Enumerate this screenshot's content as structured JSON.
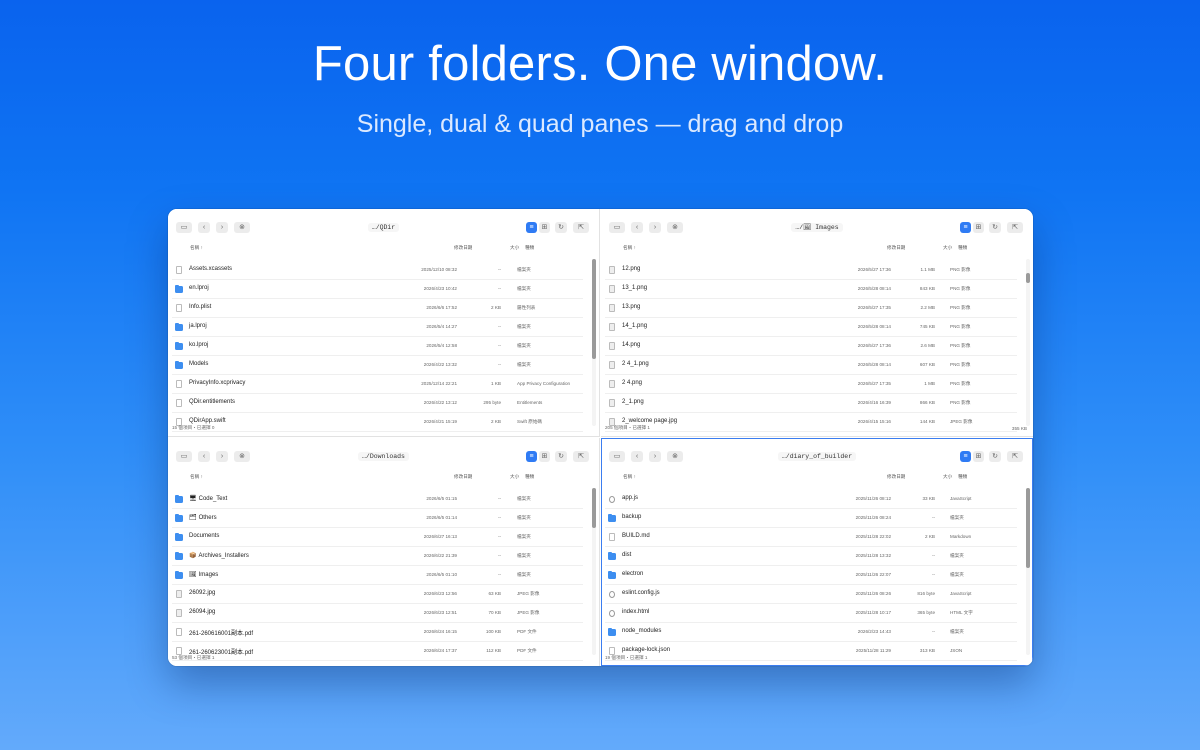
{
  "hero": {
    "title": "Four folders. One window.",
    "subtitle": "Single, dual & quad panes — drag and drop"
  },
  "colors": {
    "accent": "#2f7bf4",
    "folder": "#3d8ef0",
    "background_top": "#0a63ee"
  },
  "columns": {
    "name": "名稱 ↑",
    "date": "修改日期",
    "size": "大小",
    "kind": "種類"
  },
  "panes": [
    {
      "path": "…/QDir",
      "rows": [
        {
          "icon": "file-icon",
          "name": "Assets.xcassets",
          "date": "2025/12/10 08:32",
          "size": "--",
          "kind": "檔案夾"
        },
        {
          "icon": "folder-icon",
          "name": "en.lproj",
          "date": "2026/4/23 10:42",
          "size": "--",
          "kind": "檔案夾"
        },
        {
          "icon": "file-icon",
          "name": "Info.plist",
          "date": "2026/6/6 17:52",
          "size": "2 KB",
          "kind": "屬性列表"
        },
        {
          "icon": "folder-icon",
          "name": "ja.lproj",
          "date": "2026/5/4 14:27",
          "size": "--",
          "kind": "檔案夾"
        },
        {
          "icon": "folder-icon",
          "name": "ko.lproj",
          "date": "2026/5/4 12:58",
          "size": "--",
          "kind": "檔案夾"
        },
        {
          "icon": "folder-icon",
          "name": "Models",
          "date": "2026/4/22 13:32",
          "size": "--",
          "kind": "檔案夾"
        },
        {
          "icon": "file-icon",
          "name": "PrivacyInfo.xcprivacy",
          "date": "2025/12/14 22:21",
          "size": "1 KB",
          "kind": "App Privacy Configuration"
        },
        {
          "icon": "file-icon",
          "name": "QDir.entitlements",
          "date": "2026/4/22 13:12",
          "size": "295 byte",
          "kind": "Entitlements"
        },
        {
          "icon": "file-icon",
          "name": "QDirApp.swift",
          "date": "2026/4/21 15:19",
          "size": "2 KB",
          "kind": "Swift 原始碼"
        }
      ],
      "status": "15 個項目・已選擇 0",
      "status_right": ""
    },
    {
      "path": "…/🖼 Images",
      "rows": [
        {
          "icon": "image-icon",
          "name": "12.png",
          "date": "2026/5/27 17:36",
          "size": "1.1 MB",
          "kind": "PNG 影像"
        },
        {
          "icon": "image-icon",
          "name": "13_1.png",
          "date": "2026/5/28 08:14",
          "size": "843 KB",
          "kind": "PNG 影像"
        },
        {
          "icon": "image-icon",
          "name": "13.png",
          "date": "2026/5/27 17:35",
          "size": "2.2 MB",
          "kind": "PNG 影像"
        },
        {
          "icon": "image-icon",
          "name": "14_1.png",
          "date": "2026/5/28 08:14",
          "size": "745 KB",
          "kind": "PNG 影像"
        },
        {
          "icon": "image-icon",
          "name": "14.png",
          "date": "2026/5/27 17:36",
          "size": "2.6 MB",
          "kind": "PNG 影像"
        },
        {
          "icon": "image-icon",
          "name": "2 4_1.png",
          "date": "2026/5/28 08:14",
          "size": "607 KB",
          "kind": "PNG 影像"
        },
        {
          "icon": "image-icon",
          "name": "2 4.png",
          "date": "2026/5/27 17:35",
          "size": "1 MB",
          "kind": "PNG 影像"
        },
        {
          "icon": "image-icon",
          "name": "2_1.png",
          "date": "2026/4/16 16:39",
          "size": "866 KB",
          "kind": "PNG 影像"
        },
        {
          "icon": "image-icon",
          "name": "2_welcome page.jpg",
          "date": "2026/4/15 15:16",
          "size": "144 KB",
          "kind": "JPEG 影像"
        }
      ],
      "status": "205 個項目・已選擇 1",
      "status_right": "355 KB"
    },
    {
      "path": "…/Downloads",
      "rows": [
        {
          "icon": "folder-icon",
          "emoji": "🖥",
          "name": "Code_Text",
          "date": "2026/6/5 01:15",
          "size": "--",
          "kind": "檔案夾"
        },
        {
          "icon": "folder-icon",
          "emoji": "🗂",
          "name": "Others",
          "date": "2026/6/5 01:14",
          "size": "--",
          "kind": "檔案夾"
        },
        {
          "icon": "folder-icon",
          "emoji": "",
          "name": "Documents",
          "date": "2026/6/27 16:13",
          "size": "--",
          "kind": "檔案夾"
        },
        {
          "icon": "folder-icon",
          "emoji": "📦",
          "name": "Archives_Installers",
          "date": "2026/6/22 21:39",
          "size": "--",
          "kind": "檔案夾"
        },
        {
          "icon": "folder-icon",
          "emoji": "🖼",
          "name": "Images",
          "date": "2026/6/5 01:10",
          "size": "--",
          "kind": "檔案夾"
        },
        {
          "icon": "image-icon",
          "emoji": "",
          "name": "26092.jpg",
          "date": "2026/6/23 12:56",
          "size": "63 KB",
          "kind": "JPEG 影像"
        },
        {
          "icon": "image-icon",
          "emoji": "",
          "name": "26094.jpg",
          "date": "2026/6/23 12:51",
          "size": "70 KB",
          "kind": "JPEG 影像"
        },
        {
          "icon": "file-icon",
          "emoji": "",
          "name": "261-260616001副本.pdf",
          "date": "2026/6/24 16:15",
          "size": "100 KB",
          "kind": "PDF 文件"
        },
        {
          "icon": "file-icon",
          "emoji": "",
          "name": "261-260623001副本.pdf",
          "date": "2026/6/24 17:37",
          "size": "112 KB",
          "kind": "PDF 文件"
        }
      ],
      "status": "53 個項目・已選擇 1",
      "status_right": ""
    },
    {
      "path": "…/diary_of_builder",
      "rows": [
        {
          "icon": "js-icon",
          "name": "app.js",
          "date": "2025/11/26 08:12",
          "size": "33 KB",
          "kind": "JavaScript"
        },
        {
          "icon": "folder-icon",
          "name": "backup",
          "date": "2025/11/26 08:24",
          "size": "--",
          "kind": "檔案夾"
        },
        {
          "icon": "file-icon",
          "name": "BUILD.md",
          "date": "2025/11/28 22:02",
          "size": "2 KB",
          "kind": "Markdown"
        },
        {
          "icon": "folder-icon",
          "name": "dist",
          "date": "2025/11/28 13:32",
          "size": "--",
          "kind": "檔案夾"
        },
        {
          "icon": "folder-icon",
          "name": "electron",
          "date": "2025/11/26 22:07",
          "size": "--",
          "kind": "檔案夾"
        },
        {
          "icon": "js-icon",
          "name": "eslint.config.js",
          "date": "2025/11/26 08:26",
          "size": "816 byte",
          "kind": "JavaScript"
        },
        {
          "icon": "js-icon",
          "name": "index.html",
          "date": "2025/11/28 10:17",
          "size": "365 byte",
          "kind": "HTML 文字"
        },
        {
          "icon": "folder-icon",
          "name": "node_modules",
          "date": "2026/2/23 14:43",
          "size": "--",
          "kind": "檔案夾"
        },
        {
          "icon": "file-icon",
          "name": "package-lock.json",
          "date": "2025/11/28 11:29",
          "size": "313 KB",
          "kind": "JSON"
        }
      ],
      "status": "19 個項目・已選擇 1",
      "status_right": ""
    }
  ]
}
